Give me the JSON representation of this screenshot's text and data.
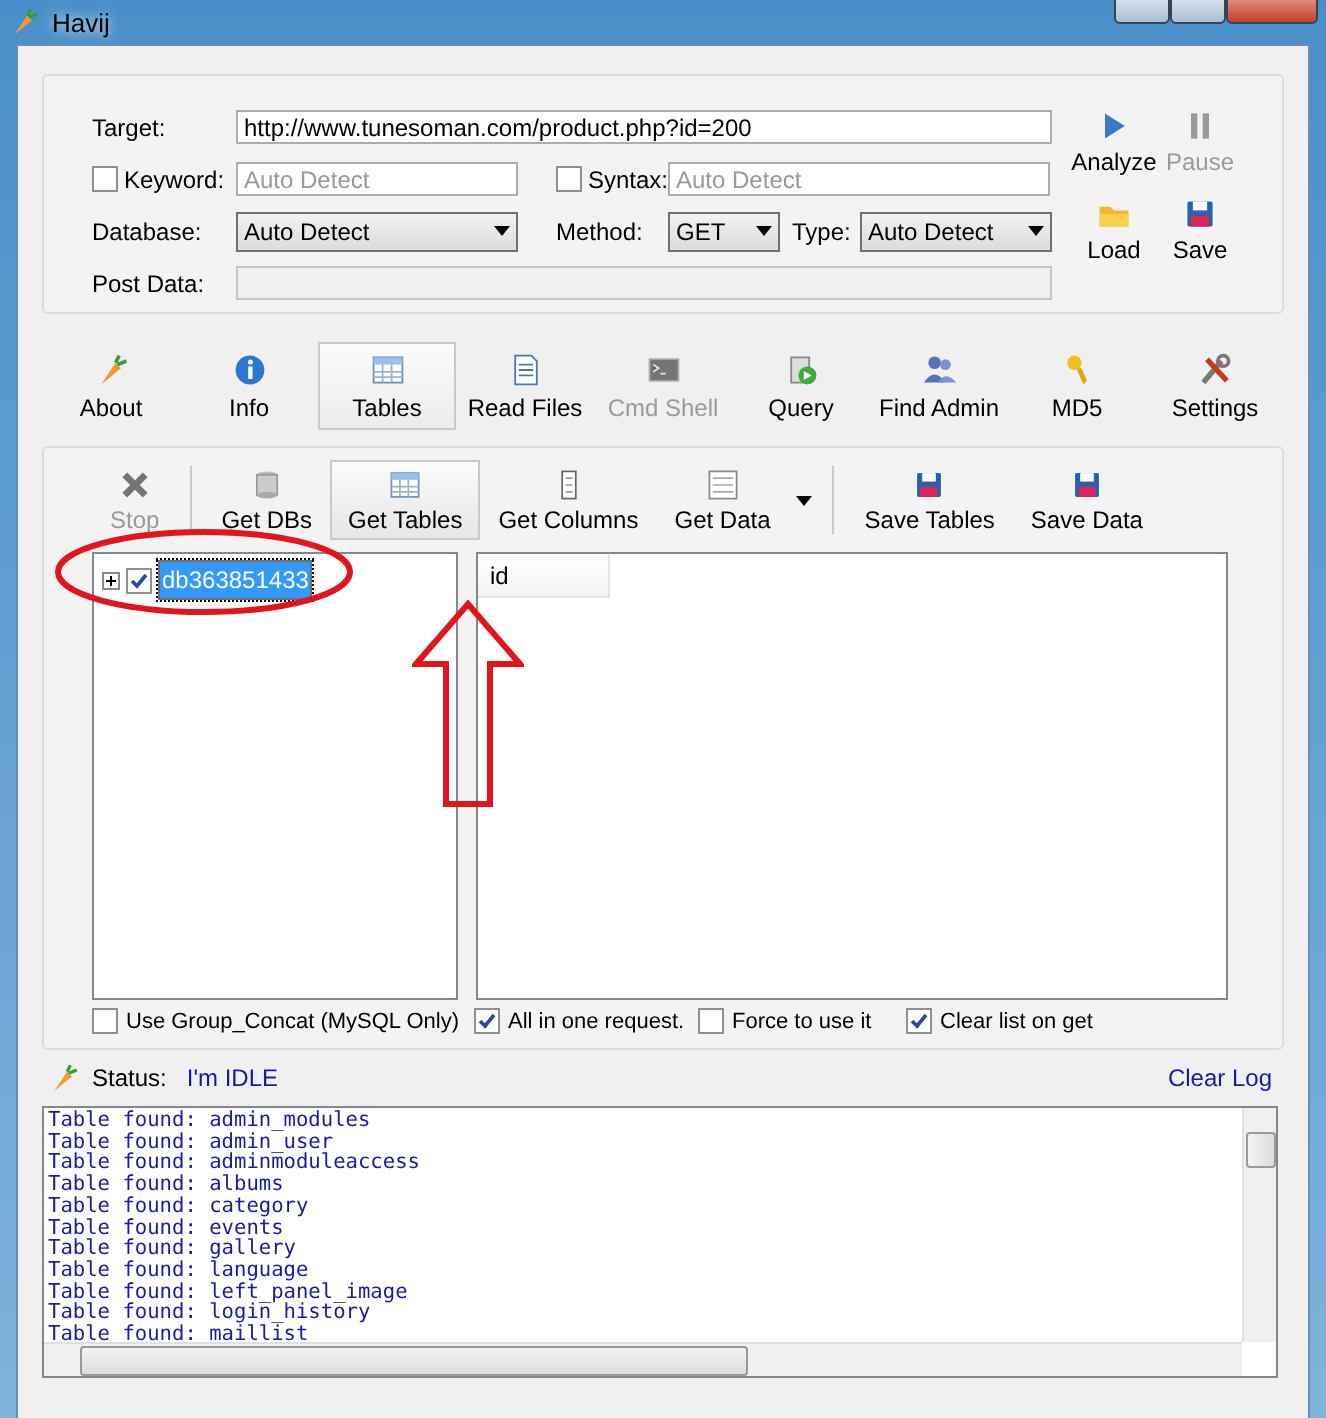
{
  "window": {
    "title": "Havij"
  },
  "target": {
    "label": "Target:",
    "value": "http://www.tunesoman.com/product.php?id=200"
  },
  "keyword": {
    "label": "Keyword:",
    "checked": false,
    "placeholder": "Auto Detect"
  },
  "syntax": {
    "label": "Syntax:",
    "checked": false,
    "placeholder": "Auto Detect"
  },
  "database": {
    "label": "Database:",
    "value": "Auto Detect"
  },
  "method": {
    "label": "Method:",
    "value": "GET"
  },
  "type": {
    "label": "Type:",
    "value": "Auto Detect"
  },
  "post_data": {
    "label": "Post Data:",
    "disabled": true
  },
  "actions": [
    {
      "label": "Analyze",
      "disabled": false
    },
    {
      "label": "Pause",
      "disabled": true
    },
    {
      "label": "Load",
      "disabled": false
    },
    {
      "label": "Save",
      "disabled": false
    }
  ],
  "tabs": [
    {
      "label": "About",
      "selected": false,
      "disabled": false
    },
    {
      "label": "Info",
      "selected": false,
      "disabled": false
    },
    {
      "label": "Tables",
      "selected": true,
      "disabled": false
    },
    {
      "label": "Read Files",
      "selected": false,
      "disabled": false
    },
    {
      "label": "Cmd Shell",
      "selected": false,
      "disabled": true
    },
    {
      "label": "Query",
      "selected": false,
      "disabled": false
    },
    {
      "label": "Find Admin",
      "selected": false,
      "disabled": false
    },
    {
      "label": "MD5",
      "selected": false,
      "disabled": false
    },
    {
      "label": "Settings",
      "selected": false,
      "disabled": false
    }
  ],
  "toolbar": [
    {
      "label": "Stop",
      "disabled": true,
      "pressed": false,
      "menu": false
    },
    {
      "label": "Get DBs",
      "disabled": false,
      "pressed": false,
      "menu": false
    },
    {
      "label": "Get Tables",
      "disabled": false,
      "pressed": true,
      "menu": false
    },
    {
      "label": "Get Columns",
      "disabled": false,
      "pressed": false,
      "menu": false
    },
    {
      "label": "Get Data",
      "disabled": false,
      "pressed": false,
      "menu": true
    },
    {
      "label": "Save Tables",
      "disabled": false,
      "pressed": false,
      "menu": false
    },
    {
      "label": "Save Data",
      "disabled": false,
      "pressed": false,
      "menu": false
    }
  ],
  "tree": [
    {
      "label": "db363851433",
      "checked": true,
      "selected": true,
      "expanded": false
    }
  ],
  "list": {
    "columns": [
      "id"
    ]
  },
  "options": [
    {
      "label": "Use Group_Concat (MySQL Only)",
      "checked": false
    },
    {
      "label": "All in one request.",
      "checked": true
    },
    {
      "label": "Force to use it",
      "checked": false
    },
    {
      "label": "Clear list on get",
      "checked": true
    }
  ],
  "status": {
    "label": "Status:",
    "value": "I'm IDLE"
  },
  "clear_log": "Clear Log",
  "log": [
    "Table found: admin_modules",
    "Table found: admin_user",
    "Table found: adminmoduleaccess",
    "Table found: albums",
    "Table found: category",
    "Table found: events",
    "Table found: gallery",
    "Table found: language",
    "Table found: left_panel_image",
    "Table found: login_history",
    "Table found: maillist"
  ]
}
